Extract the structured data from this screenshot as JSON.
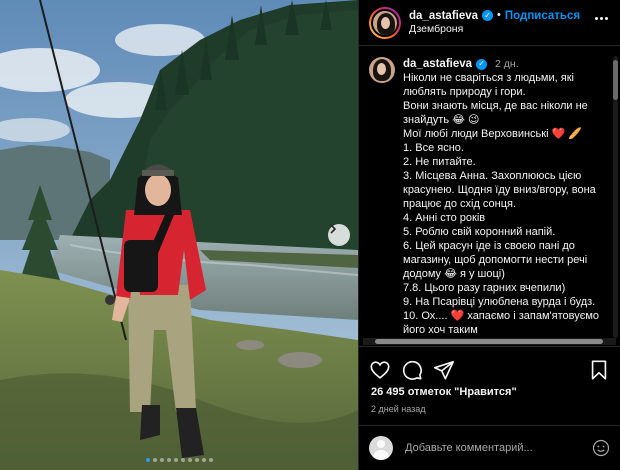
{
  "post": {
    "username": "da_astafieva",
    "follow_label": "Подписаться",
    "separator": "•",
    "location": "Дземброня",
    "verified_mark": "✓"
  },
  "caption": {
    "username": "da_astafieva",
    "time": "2 дн.",
    "lines": [
      "Ніколи не сваріться з людьми, які люблять природу і гори.",
      "Вони знають місця, де вас ніколи не знайдуть 😂 😉",
      "Мої любі люди Верховинські ❤️ 🥖",
      "1. Все ясно.",
      "2. Не питайте.",
      "3. Місцева Анна. Захоплююсь цією красунею. Щодня їду вниз/вгору, вона працює до схід сонця.",
      "4. Анні сто років",
      "5. Роблю свій коронний напій.",
      "6. Цей красун іде із своєю пані до магазину, щоб допомогти нести речі додому 😂 я у шоці)",
      "7.8. Цього разу гарних вчепили)",
      "9. На Псарівці улюблена вурда і будз.",
      "10. Ох.... ❤️ хапаємо і запам'ятовуємо його хоч таким"
    ]
  },
  "stats": {
    "likes": "26 495 отметок \"Нравится\"",
    "date": "2 дней назад"
  },
  "comment": {
    "placeholder": "Добавьте комментарий..."
  },
  "photo": {
    "slide_count": 10,
    "active_slide": 0
  },
  "colors": {
    "accent": "#0095f6",
    "background": "#000000",
    "text": "#f5f5f5",
    "muted": "#a8a8a8",
    "active_dot": "#3897f0"
  },
  "icons": [
    "next-arrow-icon",
    "verified-icon",
    "more-icon",
    "heart-icon",
    "comment-icon",
    "share-icon",
    "bookmark-icon",
    "emoji-icon"
  ]
}
